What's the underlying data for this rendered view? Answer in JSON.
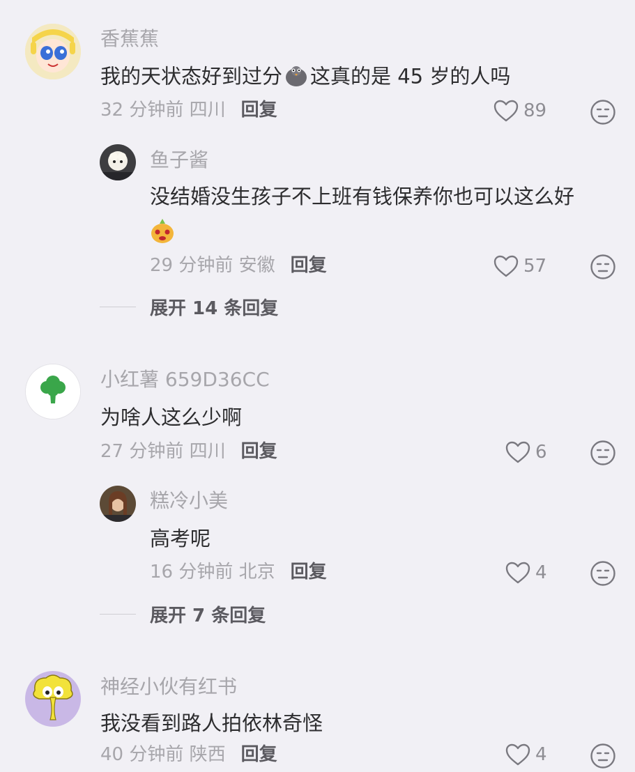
{
  "comments": [
    {
      "user": "香蕉蕉",
      "text_before": "我的天状态好到过分",
      "emoji": "pigeon-emoji",
      "text_after": "这真的是 45 岁的人吗",
      "time_location": "32 分钟前 四川",
      "reply_label": "回复",
      "likes": "89",
      "replies": [
        {
          "user": "鱼子酱",
          "text": "没结婚没生孩子不上班有钱保养你也可以这么好",
          "emoji": "cute-face-emoji",
          "time_location": "29 分钟前 安徽",
          "reply_label": "回复",
          "likes": "57"
        }
      ],
      "expand_label": "展开 14 条回复"
    },
    {
      "user": "小红薯 659D36CC",
      "text": "为啥人这么少啊",
      "time_location": "27 分钟前 四川",
      "reply_label": "回复",
      "likes": "6",
      "replies": [
        {
          "user": "糕冷小美",
          "text": "高考呢",
          "time_location": "16 分钟前 北京",
          "reply_label": "回复",
          "likes": "4"
        }
      ],
      "expand_label": "展开 7 条回复"
    },
    {
      "user": "神经小伙有红书",
      "text": "我没看到路人拍依林奇怪",
      "time_location": "40 分钟前 陕西",
      "reply_label": "回复",
      "likes": "4"
    }
  ],
  "colors": {
    "background": "#f1f0f5",
    "name": "#a7a6ab",
    "text": "#2d2d2f",
    "reply": "#5b5a60"
  }
}
